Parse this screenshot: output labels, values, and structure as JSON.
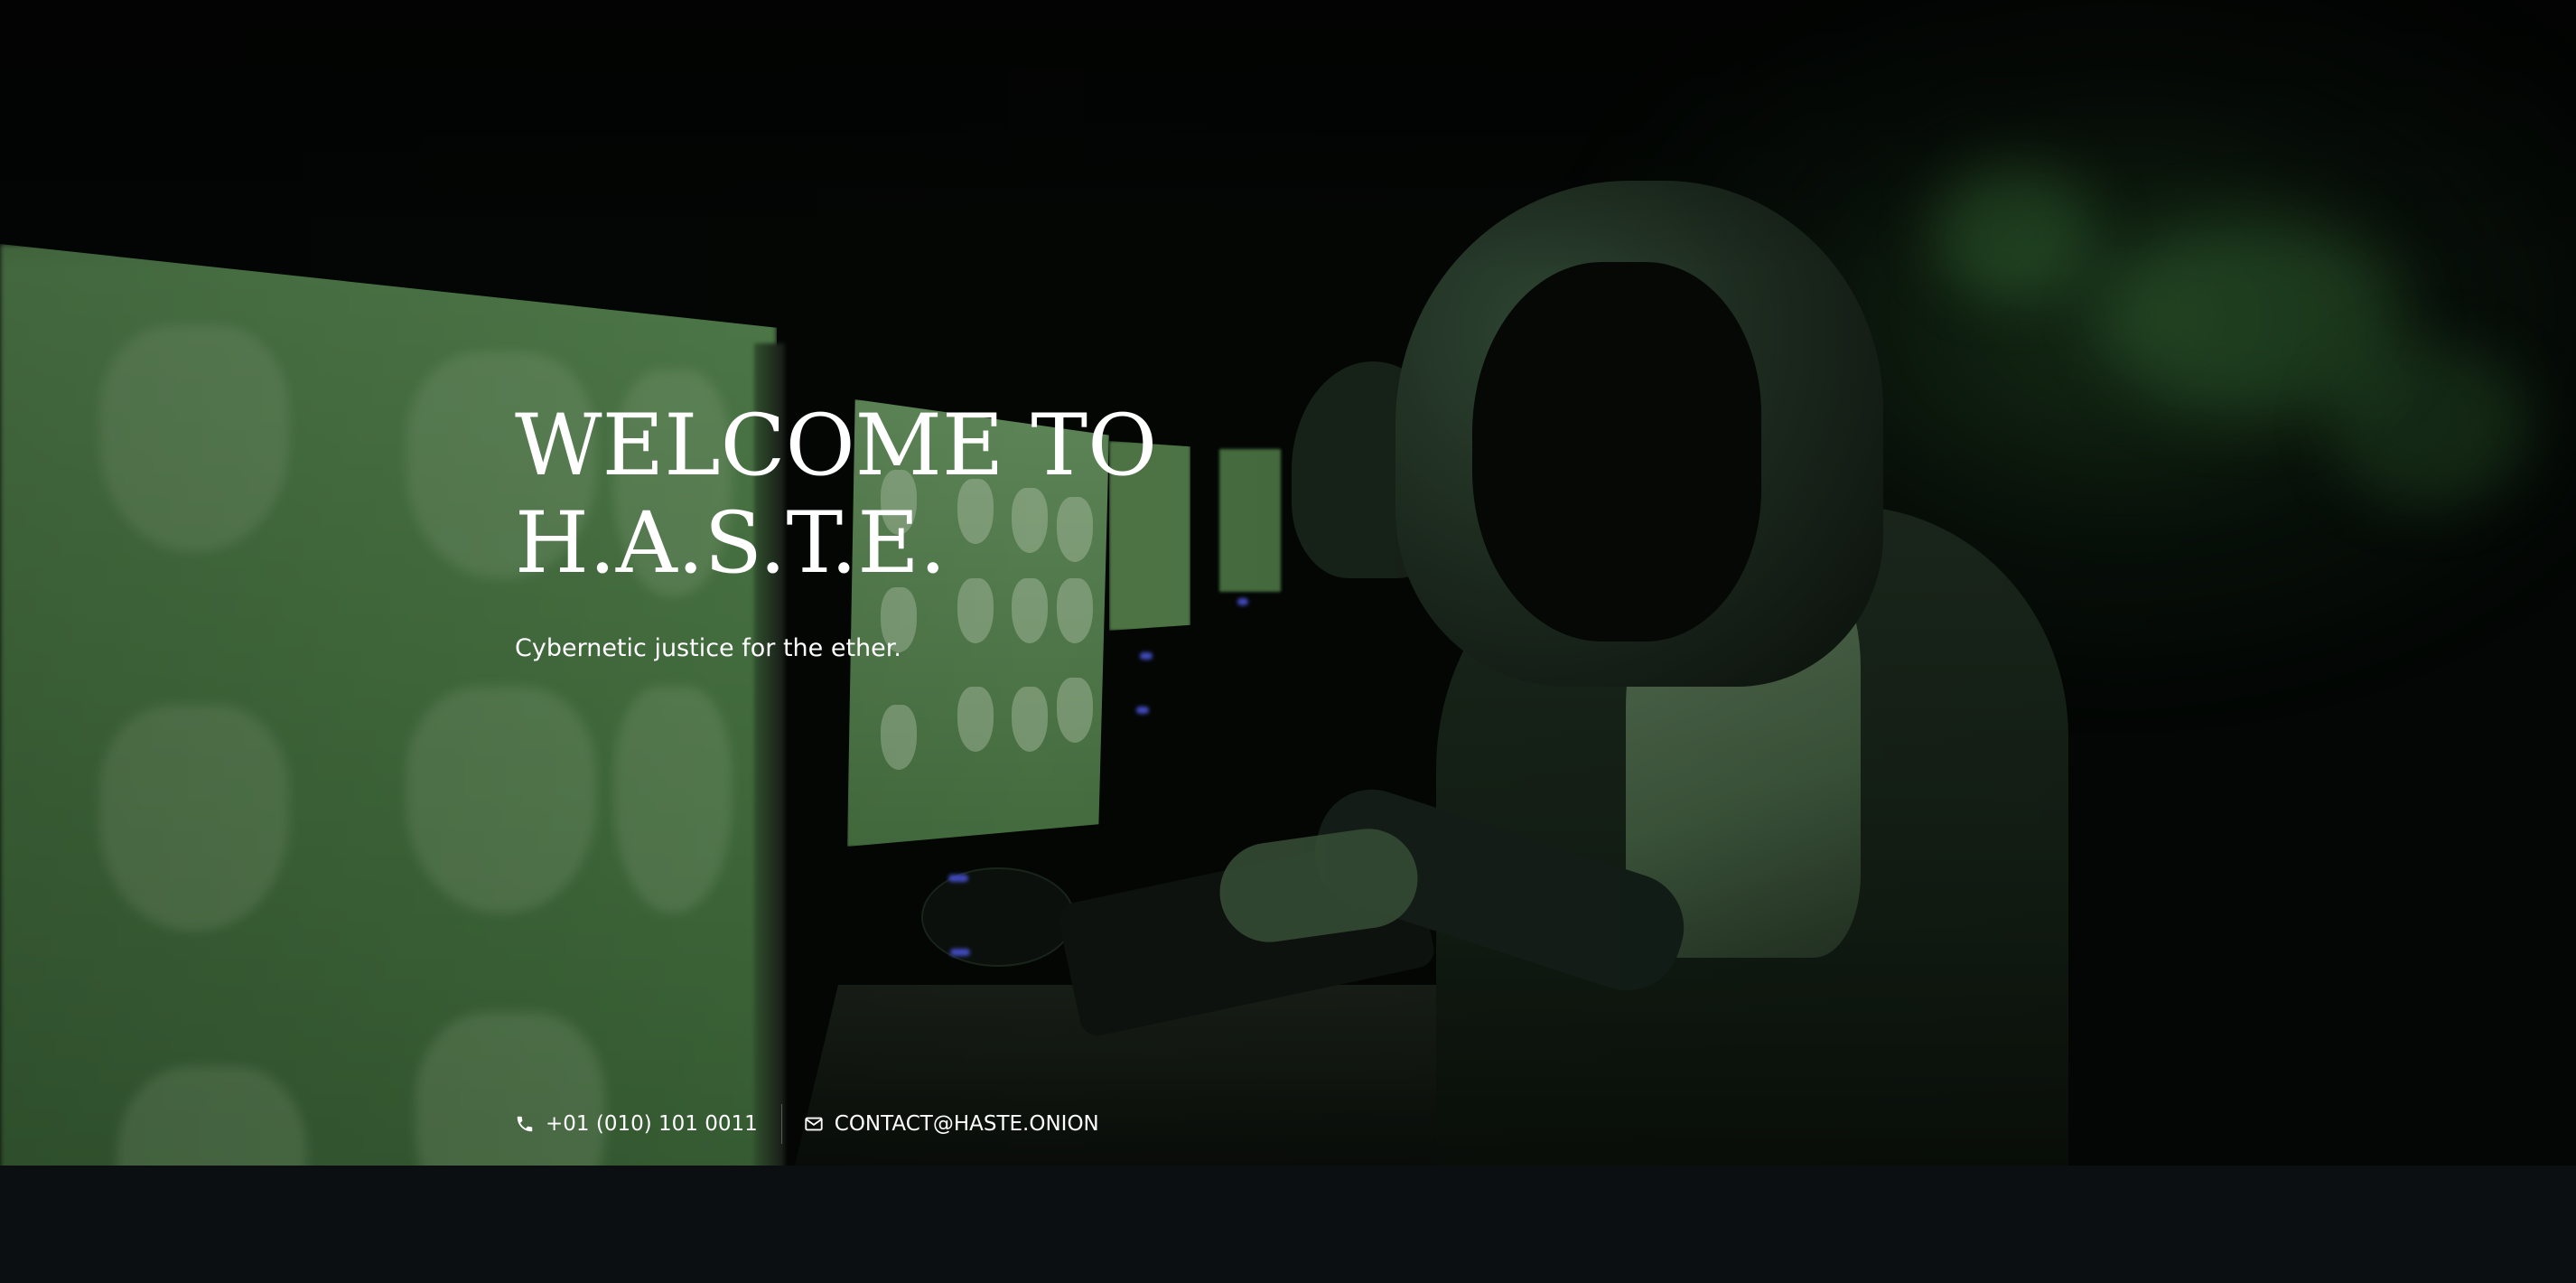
{
  "hero": {
    "title_line1": "WELCOME TO",
    "title_line2": "H.A.S.T.E.",
    "subtitle": "Cybernetic justice for the ether."
  },
  "contact": {
    "phone": "+01 (010) 101 0011",
    "phone_icon": "phone-icon",
    "email": "CONTACT@HASTE.ONION",
    "email_icon": "envelope-icon"
  },
  "colors": {
    "text": "#ffffff",
    "bottom_band": "#0b0f12",
    "screen_green": "#5d8f57"
  }
}
